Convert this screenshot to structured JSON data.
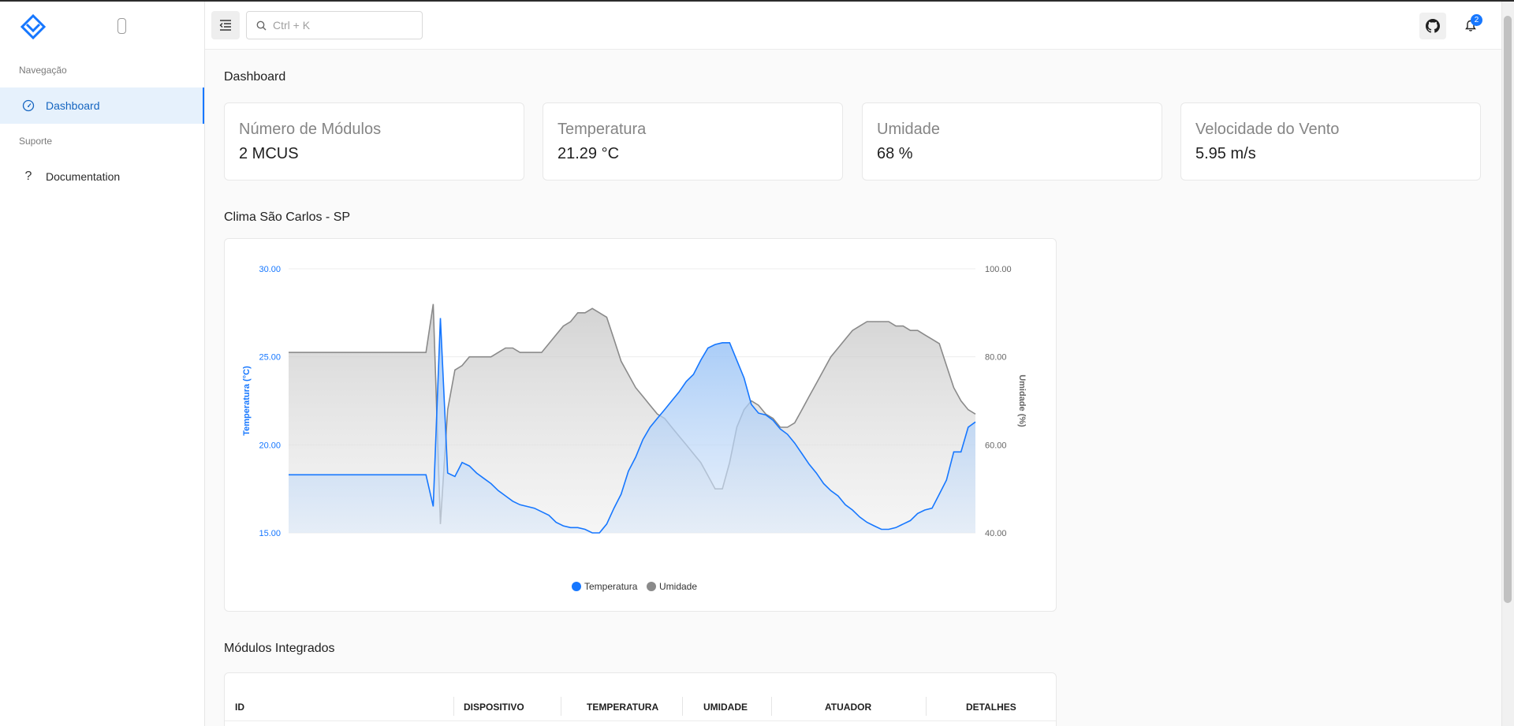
{
  "sidebar": {
    "sections": [
      {
        "label": "Navegação",
        "items": [
          {
            "label": "Dashboard",
            "icon": "gauge-icon",
            "active": true
          }
        ]
      },
      {
        "label": "Suporte",
        "items": [
          {
            "label": "Documentation",
            "icon": "question-icon",
            "active": false
          }
        ]
      }
    ]
  },
  "header": {
    "search_placeholder": "Ctrl + K",
    "notification_count": "2"
  },
  "page": {
    "title": "Dashboard"
  },
  "stats": [
    {
      "label": "Número de Módulos",
      "value": "2 MCUS"
    },
    {
      "label": "Temperatura",
      "value": "21.29 °C"
    },
    {
      "label": "Umidade",
      "value": "68 %"
    },
    {
      "label": "Velocidade do Vento",
      "value": "5.95 m/s"
    }
  ],
  "chart_section_title": "Clima São Carlos - SP",
  "modules_section_title": "Módulos Integrados",
  "chart_data": {
    "type": "area",
    "y_left": {
      "label": "Temperatura (°C)",
      "min": 15,
      "max": 30,
      "ticks": [
        "15.00",
        "20.00",
        "25.00",
        "30.00"
      ],
      "color": "#1677ff"
    },
    "y_right": {
      "label": "Umidade (%)",
      "min": 40,
      "max": 100,
      "ticks": [
        "40.00",
        "60.00",
        "80.00",
        "100.00"
      ],
      "color": "#7a7a7a"
    },
    "legend": {
      "placement": "bottom"
    },
    "series": [
      {
        "name": "Temperatura",
        "axis": "left",
        "color": "#1677ff",
        "values": [
          18.3,
          18.3,
          18.3,
          18.3,
          18.3,
          18.3,
          18.3,
          18.3,
          18.3,
          18.3,
          18.3,
          18.3,
          18.3,
          18.3,
          18.3,
          18.3,
          18.3,
          18.3,
          18.3,
          18.3,
          16.5,
          27.2,
          18.4,
          18.2,
          19.0,
          18.8,
          18.4,
          18.1,
          17.8,
          17.4,
          17.1,
          16.8,
          16.6,
          16.5,
          16.4,
          16.2,
          16.0,
          15.6,
          15.4,
          15.3,
          15.3,
          15.2,
          15.0,
          15.0,
          15.5,
          16.4,
          17.2,
          18.5,
          19.3,
          20.3,
          21.0,
          21.5,
          22.0,
          22.5,
          23.0,
          23.6,
          24.0,
          24.8,
          25.5,
          25.7,
          25.8,
          25.8,
          24.8,
          23.8,
          22.3,
          21.8,
          21.7,
          21.4,
          20.9,
          20.6,
          20.1,
          19.5,
          18.9,
          18.4,
          17.8,
          17.4,
          17.1,
          16.6,
          16.3,
          15.9,
          15.6,
          15.4,
          15.2,
          15.2,
          15.3,
          15.5,
          15.7,
          16.1,
          16.3,
          16.4,
          17.2,
          18.0,
          19.6,
          19.6,
          21.0,
          21.3
        ]
      },
      {
        "name": "Umidade",
        "axis": "right",
        "color": "#8a8a8a",
        "values": [
          81,
          81,
          81,
          81,
          81,
          81,
          81,
          81,
          81,
          81,
          81,
          81,
          81,
          81,
          81,
          81,
          81,
          81,
          81,
          81,
          92,
          42,
          68,
          77,
          78,
          80,
          80,
          80,
          80,
          81,
          82,
          82,
          81,
          81,
          81,
          81,
          83,
          85,
          87,
          88,
          90,
          90,
          91,
          90,
          89,
          84,
          79,
          76,
          73,
          71,
          69,
          67,
          66,
          64,
          62,
          60,
          58,
          56,
          53,
          50,
          50,
          56,
          64,
          68,
          70,
          69,
          67,
          66,
          64,
          64,
          65,
          68,
          71,
          74,
          77,
          80,
          82,
          84,
          86,
          87,
          88,
          88,
          88,
          88,
          87,
          87,
          86,
          86,
          85,
          84,
          83,
          78,
          73,
          70,
          68,
          67
        ]
      }
    ]
  },
  "table": {
    "columns": [
      "ID",
      "DISPOSITIVO",
      "TEMPERATURA",
      "UMIDADE",
      "ATUADOR",
      "DETALHES"
    ]
  }
}
